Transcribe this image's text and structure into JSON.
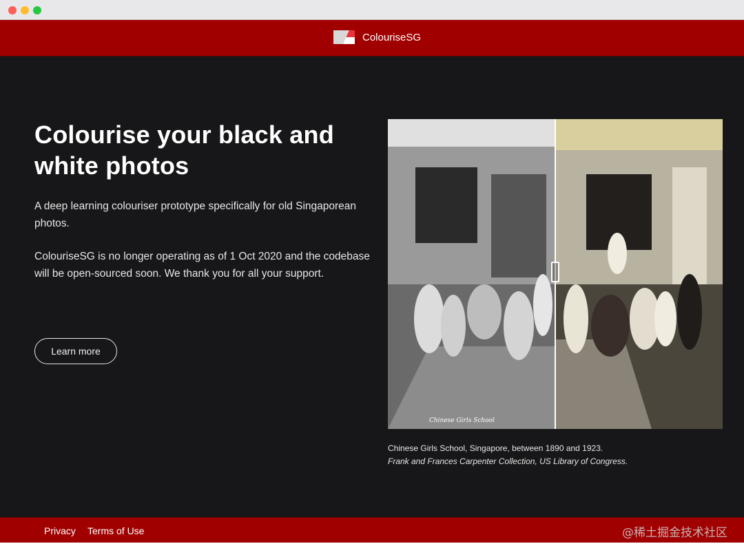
{
  "brand": {
    "name": "ColouriseSG",
    "accent_color": "#a10000"
  },
  "hero": {
    "title": "Colourise your black and white photos",
    "description": "A deep learning colouriser prototype specifically for old Singaporean photos.",
    "notice": "ColouriseSG is no longer operating as of 1 Oct 2020 and the codebase will be open-sourced soon. We thank you for all your support.",
    "learn_more_label": "Learn more"
  },
  "photo": {
    "caption": "Chinese Girls School, Singapore, between 1890 and 1923.",
    "credit": "Frank and Frances Carpenter Collection, US Library of Congress.",
    "inscription": "Chinese Girls School"
  },
  "footer": {
    "privacy_label": "Privacy",
    "terms_label": "Terms of Use",
    "watermark": "@稀土掘金技术社区"
  }
}
